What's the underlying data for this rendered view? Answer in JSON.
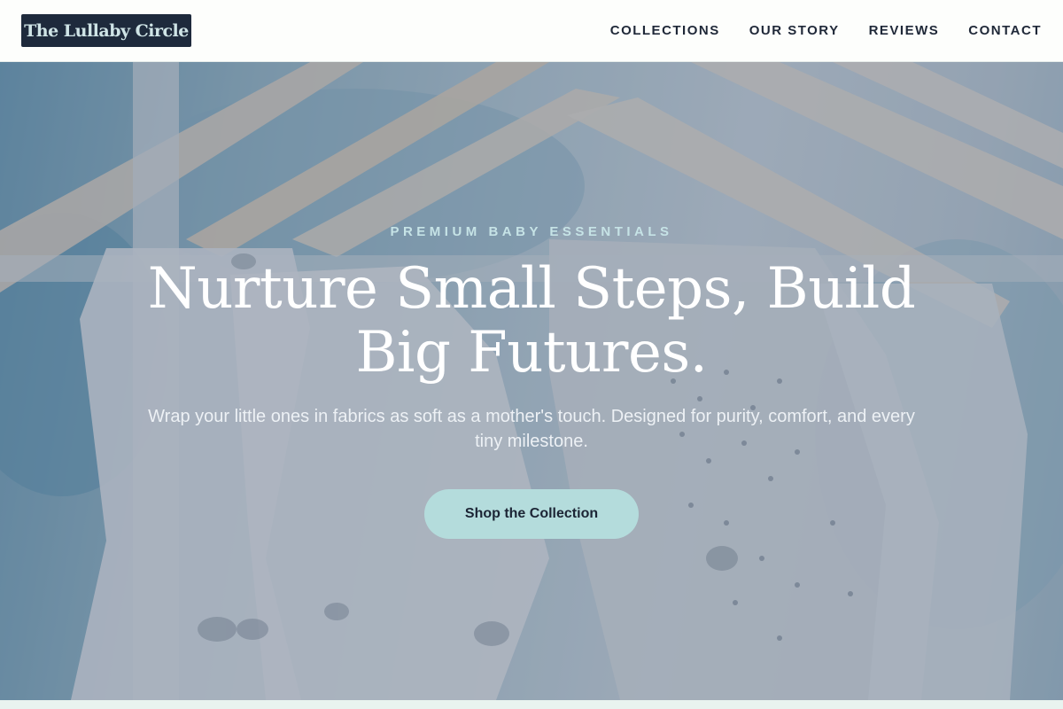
{
  "header": {
    "logo_text": "The Lullaby Circle",
    "nav": [
      {
        "label": "COLLECTIONS"
      },
      {
        "label": "OUR STORY"
      },
      {
        "label": "REVIEWS"
      },
      {
        "label": "CONTACT"
      }
    ]
  },
  "hero": {
    "eyebrow": "PREMIUM BABY ESSENTIALS",
    "headline": "Nurture Small Steps, Build Big Futures.",
    "subtext": "Wrap your little ones in fabrics as soft as a mother's touch. Designed for purity, comfort, and every tiny milestone.",
    "cta_label": "Shop the Collection",
    "background_image": "baby-clothes-on-wooden-hangers"
  },
  "colors": {
    "logo_bg": "#1e2a3c",
    "nav_text": "#1f2838",
    "accent": "#b4dcdc",
    "eyebrow": "#c6e3e6"
  }
}
